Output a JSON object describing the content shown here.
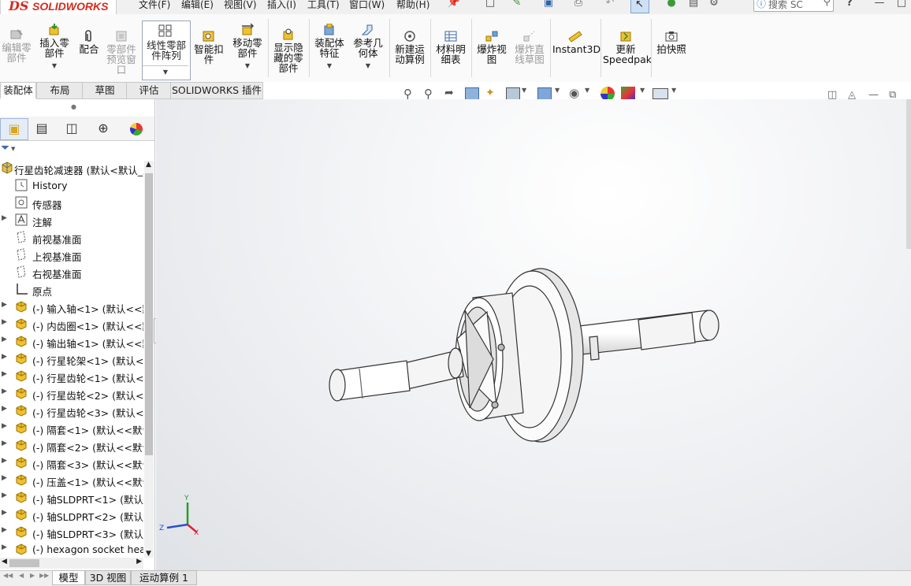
{
  "app": {
    "logo_ds": "DS",
    "logo_name": "SOLIDWORKS"
  },
  "menu": [
    "文件(F)",
    "编辑(E)",
    "视图(V)",
    "插入(I)",
    "工具(T)",
    "窗口(W)",
    "帮助(H)"
  ],
  "search": {
    "placeholder": "搜索 SC"
  },
  "ribbon": {
    "edit_component": "编辑零\n部件",
    "insert_component": "插入零\n部件",
    "mate": "配合",
    "component_preview": "零部件\n预览窗\n口",
    "linear_pattern": "线性零部\n件阵列",
    "smart_fasteners": "智能扣\n件",
    "move_component": "移动零\n部件",
    "show_hidden": "显示隐\n藏的零\n部件",
    "assembly_features": "装配体\n特征",
    "reference_geometry": "参考几\n何体",
    "new_motion_study": "新建运\n动算例",
    "bom": "材料明\n细表",
    "exploded_view": "爆炸视\n图",
    "explode_line": "爆炸直\n线草图",
    "instant3d": "Instant3D",
    "speedpak": "更新\nSpeedpak",
    "snapshot": "拍快照"
  },
  "ribbon_tabs": [
    "装配体",
    "布局",
    "草图",
    "评估",
    "SOLIDWORKS 插件"
  ],
  "tree": {
    "root": "行星齿轮减速器 (默认<默认_显",
    "items": [
      {
        "label": "History",
        "icon": "history-icon",
        "expandable": false
      },
      {
        "label": "传感器",
        "icon": "sensor-icon",
        "expandable": false
      },
      {
        "label": "注解",
        "icon": "annotation-icon",
        "expandable": true
      },
      {
        "label": "前视基准面",
        "icon": "plane-icon",
        "expandable": false
      },
      {
        "label": "上视基准面",
        "icon": "plane-icon",
        "expandable": false
      },
      {
        "label": "右视基准面",
        "icon": "plane-icon",
        "expandable": false
      },
      {
        "label": "原点",
        "icon": "origin-icon",
        "expandable": false
      },
      {
        "label": "(-) 输入轴<1> (默认<<默",
        "icon": "part-icon",
        "expandable": true
      },
      {
        "label": "(-) 内齿圈<1> (默认<<默",
        "icon": "part-icon",
        "expandable": true
      },
      {
        "label": "(-) 输出轴<1> (默认<<默",
        "icon": "part-icon",
        "expandable": true
      },
      {
        "label": "(-) 行星轮架<1> (默认<<",
        "icon": "part-icon",
        "expandable": true
      },
      {
        "label": "(-) 行星齿轮<1> (默认<<",
        "icon": "part-icon",
        "expandable": true
      },
      {
        "label": "(-) 行星齿轮<2> (默认<<",
        "icon": "part-icon",
        "expandable": true
      },
      {
        "label": "(-) 行星齿轮<3> (默认<<",
        "icon": "part-icon",
        "expandable": true
      },
      {
        "label": "(-) 隔套<1> (默认<<默认",
        "icon": "part-icon",
        "expandable": true
      },
      {
        "label": "(-) 隔套<2> (默认<<默认",
        "icon": "part-icon",
        "expandable": true
      },
      {
        "label": "(-) 隔套<3> (默认<<默认",
        "icon": "part-icon",
        "expandable": true
      },
      {
        "label": "(-) 压盖<1> (默认<<默认",
        "icon": "part-icon",
        "expandable": true
      },
      {
        "label": "(-) 轴SLDPRT<1> (默认<",
        "icon": "part-icon",
        "expandable": true
      },
      {
        "label": "(-) 轴SLDPRT<2> (默认<",
        "icon": "part-icon",
        "expandable": true
      },
      {
        "label": "(-) 轴SLDPRT<3> (默认<",
        "icon": "part-icon",
        "expandable": true
      },
      {
        "label": "(-) hexagon socket heac",
        "icon": "part-icon",
        "expandable": true
      }
    ]
  },
  "triad": {
    "y": "Y",
    "z": "Z",
    "x": "X"
  },
  "bottom_tabs": [
    "模型",
    "3D 视图",
    "运动算例 1"
  ]
}
